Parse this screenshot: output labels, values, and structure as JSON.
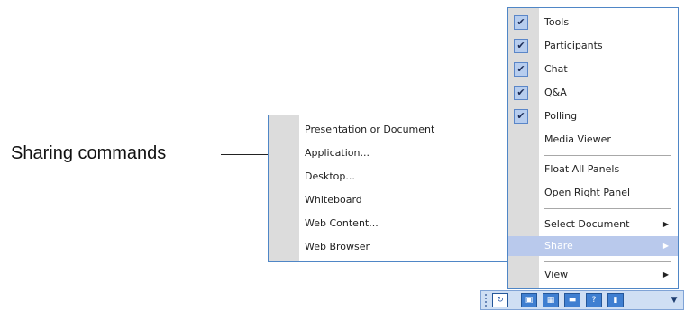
{
  "callout": {
    "label": "Sharing commands"
  },
  "main_menu": {
    "items": [
      {
        "label": "Tools",
        "checked": true
      },
      {
        "label": "Participants",
        "checked": true
      },
      {
        "label": "Chat",
        "checked": true
      },
      {
        "label": "Q&A",
        "checked": true
      },
      {
        "label": "Polling",
        "checked": true
      },
      {
        "label": "Media Viewer",
        "checked": false
      },
      {
        "label": "Float All Panels",
        "checked": false
      },
      {
        "label": "Open Right Panel",
        "checked": false
      },
      {
        "label": "Select Document",
        "checked": false,
        "submenu": true
      },
      {
        "label": "Share",
        "checked": false,
        "submenu": true,
        "highlighted": true
      },
      {
        "label": "View",
        "checked": false,
        "submenu": true
      }
    ],
    "check_glyph": "✔",
    "arrow_glyph": "▶"
  },
  "share_submenu": {
    "items": [
      {
        "label": "Presentation or Document"
      },
      {
        "label": "Application..."
      },
      {
        "label": "Desktop..."
      },
      {
        "label": "Whiteboard"
      },
      {
        "label": "Web Content..."
      },
      {
        "label": "Web Browser"
      }
    ]
  },
  "toolbar": {
    "buttons": [
      {
        "icon": "refresh-icon",
        "glyph": "↻"
      },
      {
        "icon": "document-icon",
        "glyph": "▣"
      },
      {
        "icon": "participants-icon",
        "glyph": "▦"
      },
      {
        "icon": "chat-icon",
        "glyph": "▬"
      },
      {
        "icon": "qa-icon",
        "glyph": "?"
      },
      {
        "icon": "polling-icon",
        "glyph": "▮"
      }
    ],
    "dropdown_glyph": "▼"
  },
  "colors": {
    "menu_border": "#4f86c6",
    "gutter": "#dcdcdc",
    "highlight": "#b9c9ec",
    "check_bg": "#b7cdee",
    "toolbar_bg": "#cfdff4",
    "toolbar_button": "#3f7fd1"
  }
}
